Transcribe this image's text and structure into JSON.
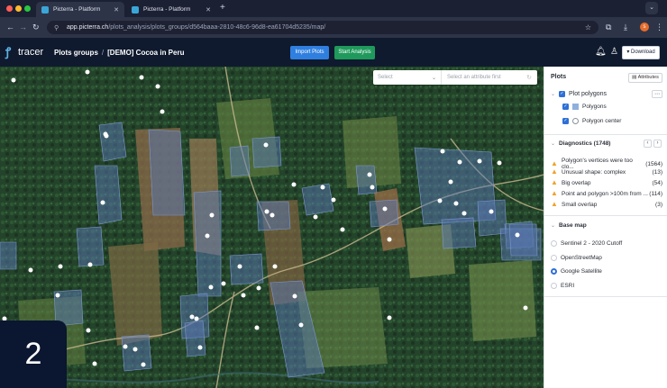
{
  "browser": {
    "tabs": [
      {
        "title": "Picterra - Platform",
        "active": true
      },
      {
        "title": "Picterra - Platform",
        "active": false
      }
    ],
    "new_tab": "+",
    "url_host": "app.picterra.ch",
    "url_path": "/plots_analysis/plots_groups/d564baaa-2810-48c6-96d8-ea61704d5235/map/",
    "profile_initial": "s",
    "colors": {
      "tabbar": "#1c2033",
      "toolbar": "#2e3448"
    }
  },
  "app": {
    "logo_text": "tracer",
    "breadcrumb": {
      "parent": "Plots groups",
      "separator": "/",
      "current": "[DEMO] Cocoa in Peru"
    },
    "import_label": "Import Plots",
    "analysis_label": "Start Analysis",
    "download_label": "Download",
    "colors": {
      "header": "#0f1a2e",
      "import": "#2f7fe0",
      "analysis": "#1f9a5c"
    }
  },
  "map": {
    "select_placeholder": "Select",
    "attribute_placeholder": "Select an attribute first"
  },
  "panel": {
    "plots": {
      "title": "Plots",
      "attributes_label": "Attributes",
      "layer_group": "Plot polygons",
      "layers": [
        "Polygons",
        "Polygon center"
      ]
    },
    "diagnostics": {
      "title": "Diagnostics (1748)",
      "items": [
        {
          "label": "Polygon's vertices were too clo...",
          "count": "(1564)"
        },
        {
          "label": "Unusual shape: complex",
          "count": "(13)"
        },
        {
          "label": "Big overlap",
          "count": "(54)"
        },
        {
          "label": "Point and polygon >100m from ...",
          "count": "(114)"
        },
        {
          "label": "Small overlap",
          "count": "(3)"
        }
      ]
    },
    "basemap": {
      "title": "Base map",
      "options": [
        "Sentinel 2 - 2020 Cutoff",
        "OpenStreetMap",
        "Google Satellite",
        "ESRI"
      ],
      "selected": "Google Satellite"
    }
  },
  "step_badge": "2"
}
